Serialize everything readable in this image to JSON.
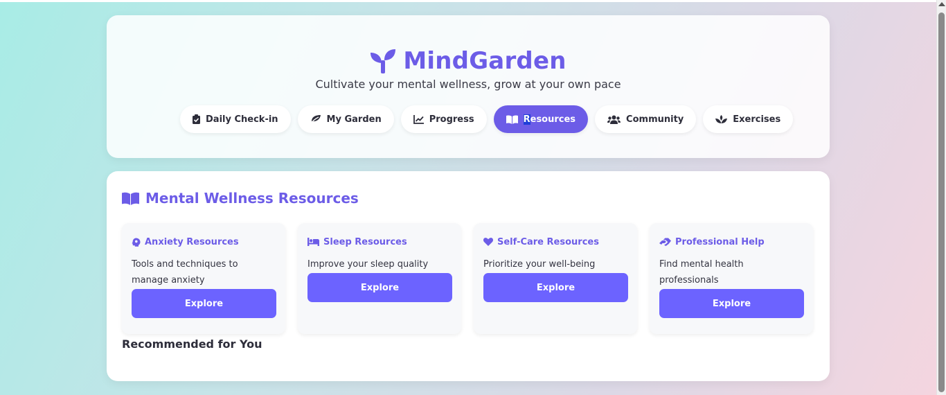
{
  "brand": {
    "title": "MindGarden",
    "tagline": "Cultivate your mental wellness, grow at your own pace",
    "icon": "seedling-icon"
  },
  "nav": [
    {
      "label": "Daily Check-in",
      "icon": "clipboard-check-icon",
      "active": false
    },
    {
      "label": "My Garden",
      "icon": "leaf-icon",
      "active": false
    },
    {
      "label": "Progress",
      "icon": "chart-line-icon",
      "active": false
    },
    {
      "label_prefix": "R",
      "label_rest": "esources",
      "icon": "book-open-icon",
      "active": true
    },
    {
      "label": "Community",
      "icon": "users-icon",
      "active": false
    },
    {
      "label": "Exercises",
      "icon": "spa-icon",
      "active": false
    }
  ],
  "section": {
    "title": "Mental Wellness Resources",
    "icon": "book-open-icon"
  },
  "resources": [
    {
      "title": "Anxiety Resources",
      "icon": "brain-icon",
      "description": "Tools and techniques to manage anxiety",
      "button": "Explore"
    },
    {
      "title": "Sleep Resources",
      "icon": "bed-icon",
      "description": "Improve your sleep quality",
      "button": "Explore"
    },
    {
      "title": "Self-Care Resources",
      "icon": "heart-icon",
      "description": "Prioritize your well-being",
      "button": "Explore"
    },
    {
      "title": "Professional Help",
      "icon": "hands-helping-icon",
      "description": "Find mental health professionals",
      "button": "Explore"
    }
  ],
  "recommended": {
    "title": "Recommended for You"
  },
  "colors": {
    "accent": "#6c5ce7",
    "button": "#6c63ff",
    "card_bg": "#f7f8fa"
  }
}
